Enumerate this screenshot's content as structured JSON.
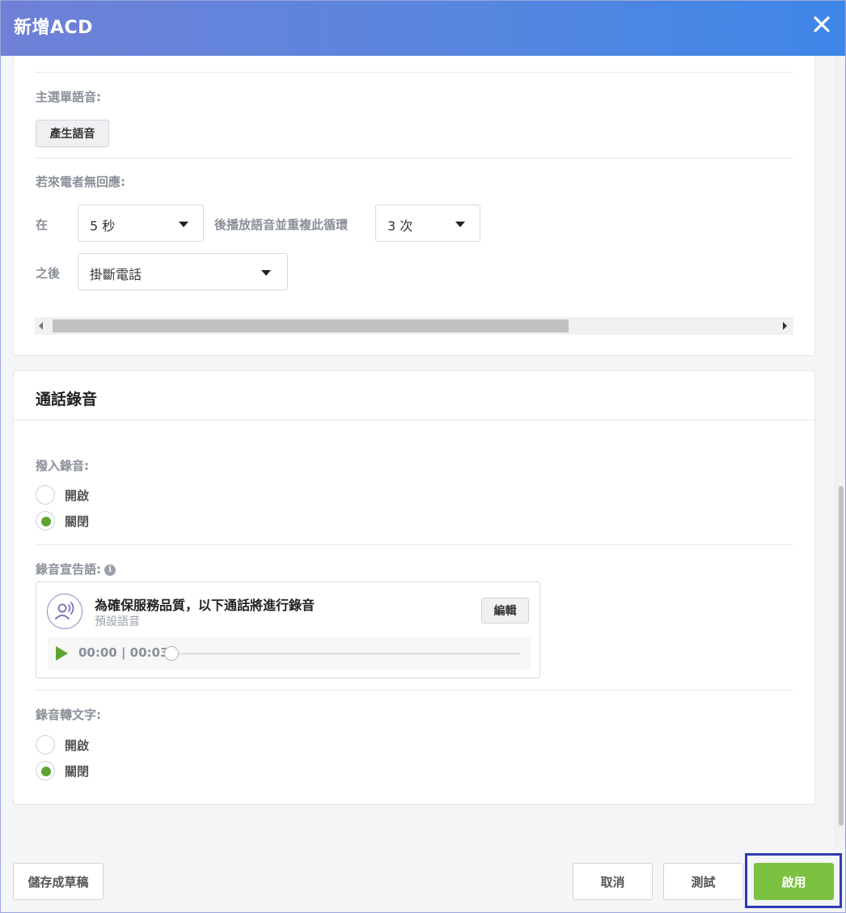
{
  "dialog": {
    "title": "新增ACD",
    "close_icon": "close-icon"
  },
  "menu_voice": {
    "label": "主選單語音:",
    "generate_button": "產生語音"
  },
  "no_response": {
    "label": "若來電者無回應:",
    "at_label": "在",
    "wait_select": "5 秒",
    "loop_label": "後播放語音並重複此循環",
    "repeat_select": "3 次",
    "after_label": "之後",
    "action_select": "掛斷電話"
  },
  "recording": {
    "section_title": "通話錄音",
    "inbound_label": "撥入錄音:",
    "inbound_options": [
      {
        "label": "開啟",
        "selected": false
      },
      {
        "label": "關閉",
        "selected": true
      }
    ],
    "announcement_label": "錄音宣告語:",
    "announcement": {
      "text": "為確保服務品質，以下通話將進行錄音",
      "subtext": "預設語音",
      "edit_button": "編輯",
      "time": "00:00 | 00:03",
      "progress": 0
    },
    "transcribe_label": "錄音轉文字:",
    "transcribe_options": [
      {
        "label": "開啟",
        "selected": false
      },
      {
        "label": "關閉",
        "selected": true
      }
    ]
  },
  "footer": {
    "save_draft": "儲存成草稿",
    "cancel": "取消",
    "test": "測試",
    "enable": "啟用"
  },
  "colors": {
    "header_start": "#6f80d6",
    "header_end": "#3e86e8",
    "accent_green": "#7dc142",
    "radio_green": "#5ca430",
    "highlight_border": "#2f3bb3"
  }
}
